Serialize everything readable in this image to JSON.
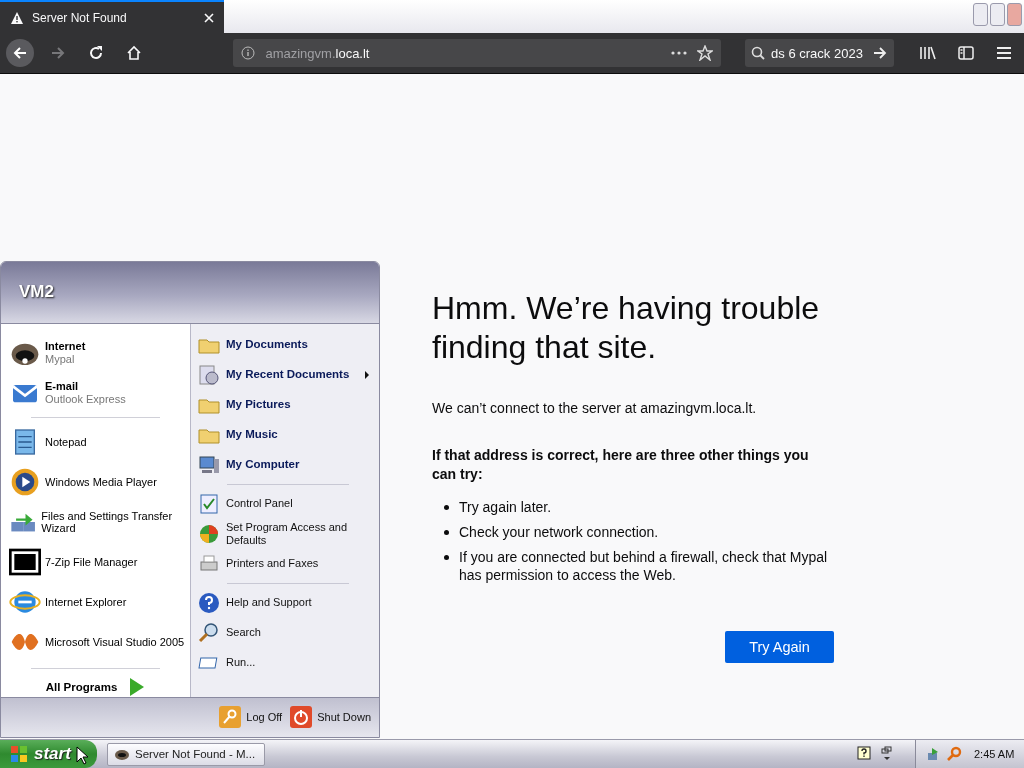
{
  "browser": {
    "tabs": [
      {
        "title": "Server Not Found",
        "selected": true
      }
    ],
    "url": {
      "subdomain": "amazingvm.",
      "domain": "loca.lt"
    },
    "search": {
      "value": "ds 6 crack 2023"
    }
  },
  "error_page": {
    "title": "Hmm. We’re having trouble finding that site.",
    "message": "We can’t connect to the server at amazingvm.loca.lt.",
    "subheading": "If that address is correct, here are three other things you can try:",
    "tips": [
      "Try again later.",
      "Check your network connection.",
      "If you are connected but behind a firewall, check that Mypal has permission to access the Web."
    ],
    "button": "Try Again"
  },
  "start_menu": {
    "user": "VM2",
    "pinned": [
      {
        "title": "Internet",
        "subtitle": "Mypal"
      },
      {
        "title": "E-mail",
        "subtitle": "Outlook Express"
      }
    ],
    "recent": [
      "Notepad",
      "Windows Media Player",
      "Files and Settings Transfer Wizard",
      "7-Zip File Manager",
      "Internet Explorer",
      "Microsoft Visual Studio 2005"
    ],
    "all_programs": "All Programs",
    "places": [
      [
        {
          "label": "My Documents",
          "submenu": false
        },
        {
          "label": "My Recent Documents",
          "submenu": true
        },
        {
          "label": "My Pictures",
          "submenu": false
        },
        {
          "label": "My Music",
          "submenu": false
        },
        {
          "label": "My Computer",
          "submenu": false
        }
      ],
      [
        {
          "label": "Control Panel",
          "submenu": false
        },
        {
          "label": "Set Program Access and Defaults",
          "submenu": false
        },
        {
          "label": "Printers and Faxes",
          "submenu": false
        }
      ],
      [
        {
          "label": "Help and Support",
          "submenu": false
        },
        {
          "label": "Search",
          "submenu": false
        },
        {
          "label": "Run...",
          "submenu": false
        }
      ]
    ],
    "footer": [
      "Log Off",
      "Shut Down"
    ]
  },
  "taskbar": {
    "start": "start",
    "tasks": [
      "Server Not Found - M..."
    ],
    "clock": "2:45 AM"
  }
}
